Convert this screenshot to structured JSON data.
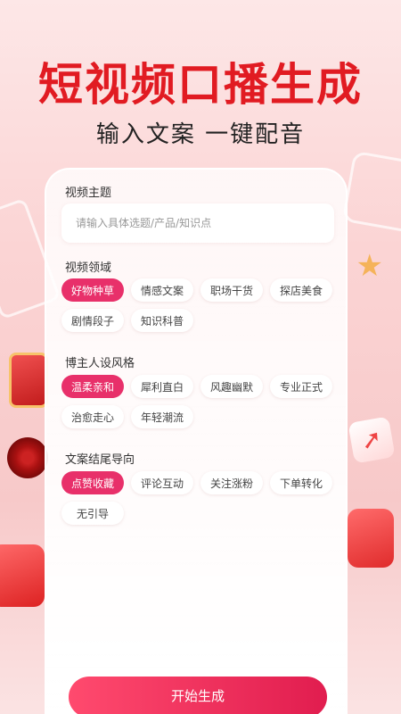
{
  "hero": {
    "title": "短视频口播生成",
    "subtitle": "输入文案 一键配音"
  },
  "topic": {
    "label": "视频主题",
    "placeholder": "请输入具体选题/产品/知识点",
    "value": ""
  },
  "domain": {
    "label": "视频领域",
    "options": [
      "好物种草",
      "情感文案",
      "职场干货",
      "探店美食",
      "剧情段子",
      "知识科普"
    ],
    "selected": "好物种草"
  },
  "style": {
    "label": "博主人设风格",
    "options": [
      "温柔亲和",
      "犀利直白",
      "风趣幽默",
      "专业正式",
      "治愈走心",
      "年轻潮流"
    ],
    "selected": "温柔亲和"
  },
  "ending": {
    "label": "文案结尾导向",
    "options": [
      "点赞收藏",
      "评论互动",
      "关注涨粉",
      "下单转化",
      "无引导"
    ],
    "selected": "点赞收藏"
  },
  "action": {
    "start_label": "开始生成"
  },
  "colors": {
    "brand_red": "#e11b22",
    "chip_selected": "#e8306a",
    "button_gradient_start": "#ff4a6e",
    "button_gradient_end": "#e11d4f"
  }
}
